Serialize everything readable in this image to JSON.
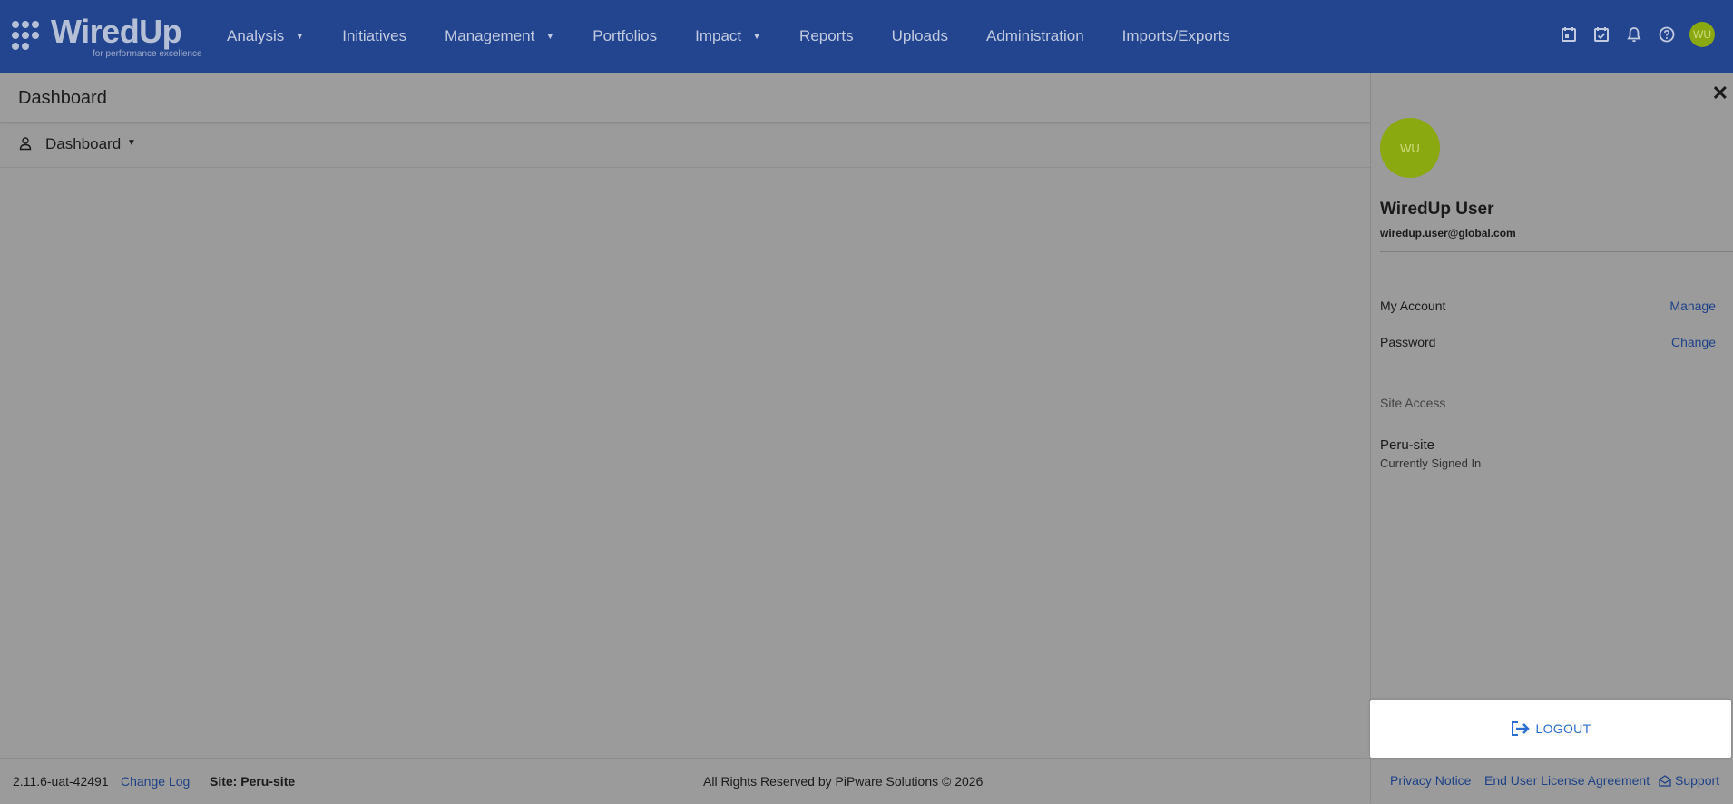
{
  "brand": {
    "name": "WiredUp",
    "tagline": "for performance excellence"
  },
  "nav": {
    "items": [
      {
        "label": "Analysis",
        "has_dropdown": true
      },
      {
        "label": "Initiatives",
        "has_dropdown": false
      },
      {
        "label": "Management",
        "has_dropdown": true
      },
      {
        "label": "Portfolios",
        "has_dropdown": false
      },
      {
        "label": "Impact",
        "has_dropdown": true
      },
      {
        "label": "Reports",
        "has_dropdown": false
      },
      {
        "label": "Uploads",
        "has_dropdown": false
      },
      {
        "label": "Administration",
        "has_dropdown": false
      },
      {
        "label": "Imports/Exports",
        "has_dropdown": false
      }
    ],
    "icons": [
      "calendar-icon",
      "calendar-check-icon",
      "bell-icon",
      "help-icon"
    ],
    "avatar_initials": "WU"
  },
  "page": {
    "title": "Dashboard",
    "dashboard_selector": "Dashboard"
  },
  "footer": {
    "version": "2.11.6-uat-42491",
    "change_log": "Change Log",
    "site": "Site: Peru-site",
    "rights": "All Rights Reserved by PiPware Solutions © 2026",
    "privacy": "Privacy Notice",
    "eula": "End User License Agreement",
    "support": "Support"
  },
  "user_panel": {
    "avatar_initials": "WU",
    "name": "WiredUp User",
    "email": "wiredup.user@global.com",
    "my_account_label": "My Account",
    "manage_link": "Manage",
    "password_label": "Password",
    "change_link": "Change",
    "site_access_label": "Site Access",
    "site_name": "Peru-site",
    "site_status": "Currently Signed In",
    "logout_label": "LOGOUT"
  },
  "colors": {
    "nav_bg": "#23458f",
    "avatar": "#8aa80f",
    "link": "#1d4187",
    "logout": "#2b6ed2"
  }
}
